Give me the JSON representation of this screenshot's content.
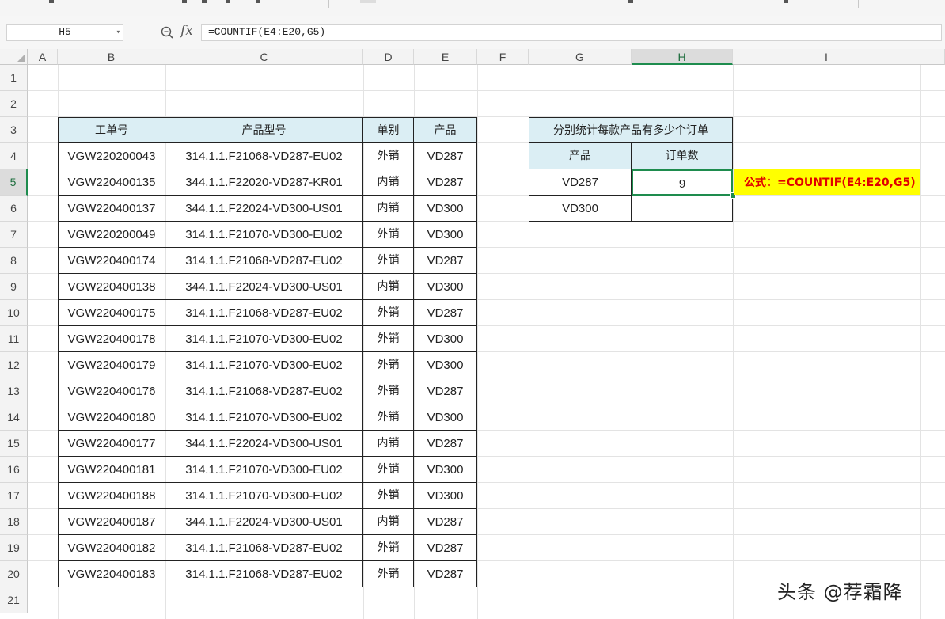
{
  "name_box": "H5",
  "formula": "=COUNTIF(E4:E20,G5)",
  "columns": [
    "A",
    "B",
    "C",
    "D",
    "E",
    "F",
    "G",
    "H",
    "I"
  ],
  "rows": [
    "1",
    "2",
    "3",
    "4",
    "5",
    "6",
    "7",
    "8",
    "9",
    "10",
    "11",
    "12",
    "13",
    "14",
    "15",
    "16",
    "17",
    "18",
    "19",
    "20",
    "21"
  ],
  "active_cell": "H5",
  "main_table": {
    "headers": [
      "工单号",
      "产品型号",
      "单别",
      "产品"
    ],
    "rows": [
      [
        "VGW220200043",
        "314.1.1.F21068-VD287-EU02",
        "外销",
        "VD287"
      ],
      [
        "VGW220400135",
        "344.1.1.F22020-VD287-KR01",
        "内销",
        "VD287"
      ],
      [
        "VGW220400137",
        "344.1.1.F22024-VD300-US01",
        "内销",
        "VD300"
      ],
      [
        "VGW220200049",
        "314.1.1.F21070-VD300-EU02",
        "外销",
        "VD300"
      ],
      [
        "VGW220400174",
        "314.1.1.F21068-VD287-EU02",
        "外销",
        "VD287"
      ],
      [
        "VGW220400138",
        "344.1.1.F22024-VD300-US01",
        "内销",
        "VD300"
      ],
      [
        "VGW220400175",
        "314.1.1.F21068-VD287-EU02",
        "外销",
        "VD287"
      ],
      [
        "VGW220400178",
        "314.1.1.F21070-VD300-EU02",
        "外销",
        "VD300"
      ],
      [
        "VGW220400179",
        "314.1.1.F21070-VD300-EU02",
        "外销",
        "VD300"
      ],
      [
        "VGW220400176",
        "314.1.1.F21068-VD287-EU02",
        "外销",
        "VD287"
      ],
      [
        "VGW220400180",
        "314.1.1.F21070-VD300-EU02",
        "外销",
        "VD300"
      ],
      [
        "VGW220400177",
        "344.1.1.F22024-VD300-US01",
        "内销",
        "VD287"
      ],
      [
        "VGW220400181",
        "314.1.1.F21070-VD300-EU02",
        "外销",
        "VD300"
      ],
      [
        "VGW220400188",
        "314.1.1.F21070-VD300-EU02",
        "外销",
        "VD300"
      ],
      [
        "VGW220400187",
        "344.1.1.F22024-VD300-US01",
        "内销",
        "VD287"
      ],
      [
        "VGW220400182",
        "314.1.1.F21068-VD287-EU02",
        "外销",
        "VD287"
      ],
      [
        "VGW220400183",
        "314.1.1.F21068-VD287-EU02",
        "外销",
        "VD287"
      ]
    ]
  },
  "summary_table": {
    "title": "分别统计每款产品有多少个订单",
    "headers": [
      "产品",
      "订单数"
    ],
    "rows": [
      [
        "VD287",
        "9"
      ],
      [
        "VD300",
        ""
      ]
    ]
  },
  "note": "公式：=COUNTIF(E4:E20,G5)",
  "watermark": "头条 @荐霜降",
  "colors": {
    "header_fill": "#dbeef4",
    "selection": "#1e8c4e",
    "note_fill": "#ffff00",
    "note_text": "#e00000"
  },
  "icons": [
    "zoom-icon",
    "fx-icon",
    "dropdown-arrow-icon",
    "select-all-icon"
  ]
}
